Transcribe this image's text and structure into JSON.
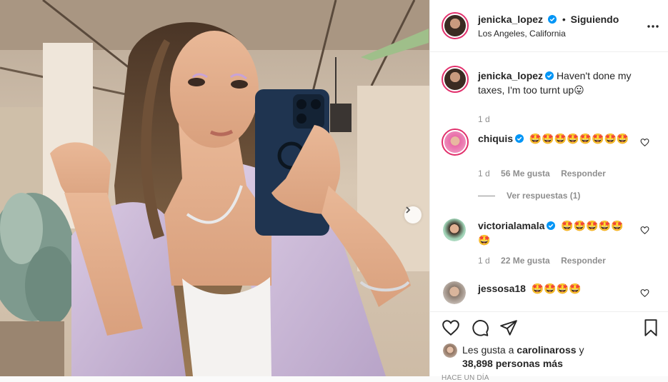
{
  "post": {
    "author": "jenicka_lopez",
    "separator": "•",
    "follow_label": "Siguiendo",
    "location": "Los Angeles, California",
    "caption": "Haven't done my taxes, I'm too turnt up😛",
    "caption_age": "1 d"
  },
  "comments": [
    {
      "user": "chiquis",
      "text": "🤩🤩🤩🤩🤩🤩🤩🤩",
      "age": "1 d",
      "likes": "56 Me gusta",
      "reply": "Responder",
      "view_replies": "Ver respuestas (1)"
    },
    {
      "user": "victorialamala",
      "text": "🤩🤩🤩🤩🤩🤩",
      "age": "1 d",
      "likes": "22 Me gusta",
      "reply": "Responder"
    },
    {
      "user": "jessosa18",
      "text": "🤩🤩🤩🤩"
    }
  ],
  "likes_summary": {
    "prefix": "Les gusta a",
    "user": "carolinaross",
    "connector": "y",
    "count": "38,898 personas más"
  },
  "date_label": "HACE UN DÍA",
  "icons": {
    "verified": "verified-badge-icon",
    "more": "more-options-icon",
    "like": "heart-icon",
    "comment": "comment-icon",
    "share": "share-icon",
    "save": "bookmark-icon",
    "next": "chevron-right-icon"
  },
  "colors": {
    "accent": "#0095f6",
    "text": "#262626",
    "muted": "#8e8e8e",
    "border": "#efefef",
    "story_ring": "#e1306c"
  }
}
